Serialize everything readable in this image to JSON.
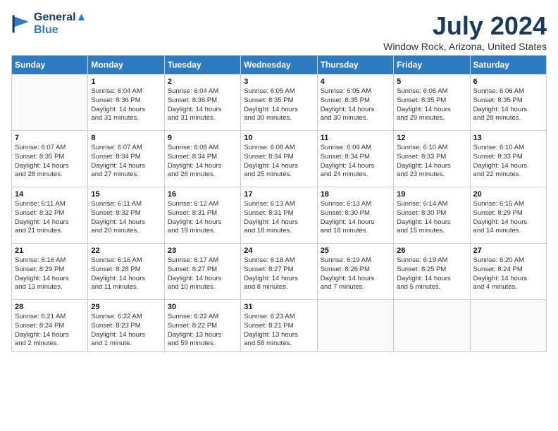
{
  "header": {
    "logo_line1": "General",
    "logo_line2": "Blue",
    "title": "July 2024",
    "location": "Window Rock, Arizona, United States"
  },
  "days_of_week": [
    "Sunday",
    "Monday",
    "Tuesday",
    "Wednesday",
    "Thursday",
    "Friday",
    "Saturday"
  ],
  "weeks": [
    [
      {
        "day": "",
        "info": ""
      },
      {
        "day": "1",
        "info": "Sunrise: 6:04 AM\nSunset: 8:36 PM\nDaylight: 14 hours\nand 31 minutes."
      },
      {
        "day": "2",
        "info": "Sunrise: 6:04 AM\nSunset: 8:36 PM\nDaylight: 14 hours\nand 31 minutes."
      },
      {
        "day": "3",
        "info": "Sunrise: 6:05 AM\nSunset: 8:35 PM\nDaylight: 14 hours\nand 30 minutes."
      },
      {
        "day": "4",
        "info": "Sunrise: 6:05 AM\nSunset: 8:35 PM\nDaylight: 14 hours\nand 30 minutes."
      },
      {
        "day": "5",
        "info": "Sunrise: 6:06 AM\nSunset: 8:35 PM\nDaylight: 14 hours\nand 29 minutes."
      },
      {
        "day": "6",
        "info": "Sunrise: 6:06 AM\nSunset: 8:35 PM\nDaylight: 14 hours\nand 28 minutes."
      }
    ],
    [
      {
        "day": "7",
        "info": "Sunrise: 6:07 AM\nSunset: 8:35 PM\nDaylight: 14 hours\nand 28 minutes."
      },
      {
        "day": "8",
        "info": "Sunrise: 6:07 AM\nSunset: 8:34 PM\nDaylight: 14 hours\nand 27 minutes."
      },
      {
        "day": "9",
        "info": "Sunrise: 6:08 AM\nSunset: 8:34 PM\nDaylight: 14 hours\nand 26 minutes."
      },
      {
        "day": "10",
        "info": "Sunrise: 6:08 AM\nSunset: 8:34 PM\nDaylight: 14 hours\nand 25 minutes."
      },
      {
        "day": "11",
        "info": "Sunrise: 6:09 AM\nSunset: 8:34 PM\nDaylight: 14 hours\nand 24 minutes."
      },
      {
        "day": "12",
        "info": "Sunrise: 6:10 AM\nSunset: 8:33 PM\nDaylight: 14 hours\nand 23 minutes."
      },
      {
        "day": "13",
        "info": "Sunrise: 6:10 AM\nSunset: 8:33 PM\nDaylight: 14 hours\nand 22 minutes."
      }
    ],
    [
      {
        "day": "14",
        "info": "Sunrise: 6:11 AM\nSunset: 8:32 PM\nDaylight: 14 hours\nand 21 minutes."
      },
      {
        "day": "15",
        "info": "Sunrise: 6:11 AM\nSunset: 8:32 PM\nDaylight: 14 hours\nand 20 minutes."
      },
      {
        "day": "16",
        "info": "Sunrise: 6:12 AM\nSunset: 8:31 PM\nDaylight: 14 hours\nand 19 minutes."
      },
      {
        "day": "17",
        "info": "Sunrise: 6:13 AM\nSunset: 8:31 PM\nDaylight: 14 hours\nand 18 minutes."
      },
      {
        "day": "18",
        "info": "Sunrise: 6:13 AM\nSunset: 8:30 PM\nDaylight: 14 hours\nand 16 minutes."
      },
      {
        "day": "19",
        "info": "Sunrise: 6:14 AM\nSunset: 8:30 PM\nDaylight: 14 hours\nand 15 minutes."
      },
      {
        "day": "20",
        "info": "Sunrise: 6:15 AM\nSunset: 8:29 PM\nDaylight: 14 hours\nand 14 minutes."
      }
    ],
    [
      {
        "day": "21",
        "info": "Sunrise: 6:16 AM\nSunset: 8:29 PM\nDaylight: 14 hours\nand 13 minutes."
      },
      {
        "day": "22",
        "info": "Sunrise: 6:16 AM\nSunset: 8:28 PM\nDaylight: 14 hours\nand 11 minutes."
      },
      {
        "day": "23",
        "info": "Sunrise: 6:17 AM\nSunset: 8:27 PM\nDaylight: 14 hours\nand 10 minutes."
      },
      {
        "day": "24",
        "info": "Sunrise: 6:18 AM\nSunset: 8:27 PM\nDaylight: 14 hours\nand 8 minutes."
      },
      {
        "day": "25",
        "info": "Sunrise: 6:19 AM\nSunset: 8:26 PM\nDaylight: 14 hours\nand 7 minutes."
      },
      {
        "day": "26",
        "info": "Sunrise: 6:19 AM\nSunset: 8:25 PM\nDaylight: 14 hours\nand 5 minutes."
      },
      {
        "day": "27",
        "info": "Sunrise: 6:20 AM\nSunset: 8:24 PM\nDaylight: 14 hours\nand 4 minutes."
      }
    ],
    [
      {
        "day": "28",
        "info": "Sunrise: 6:21 AM\nSunset: 8:24 PM\nDaylight: 14 hours\nand 2 minutes."
      },
      {
        "day": "29",
        "info": "Sunrise: 6:22 AM\nSunset: 8:23 PM\nDaylight: 14 hours\nand 1 minute."
      },
      {
        "day": "30",
        "info": "Sunrise: 6:22 AM\nSunset: 8:22 PM\nDaylight: 13 hours\nand 59 minutes."
      },
      {
        "day": "31",
        "info": "Sunrise: 6:23 AM\nSunset: 8:21 PM\nDaylight: 13 hours\nand 58 minutes."
      },
      {
        "day": "",
        "info": ""
      },
      {
        "day": "",
        "info": ""
      },
      {
        "day": "",
        "info": ""
      }
    ]
  ]
}
